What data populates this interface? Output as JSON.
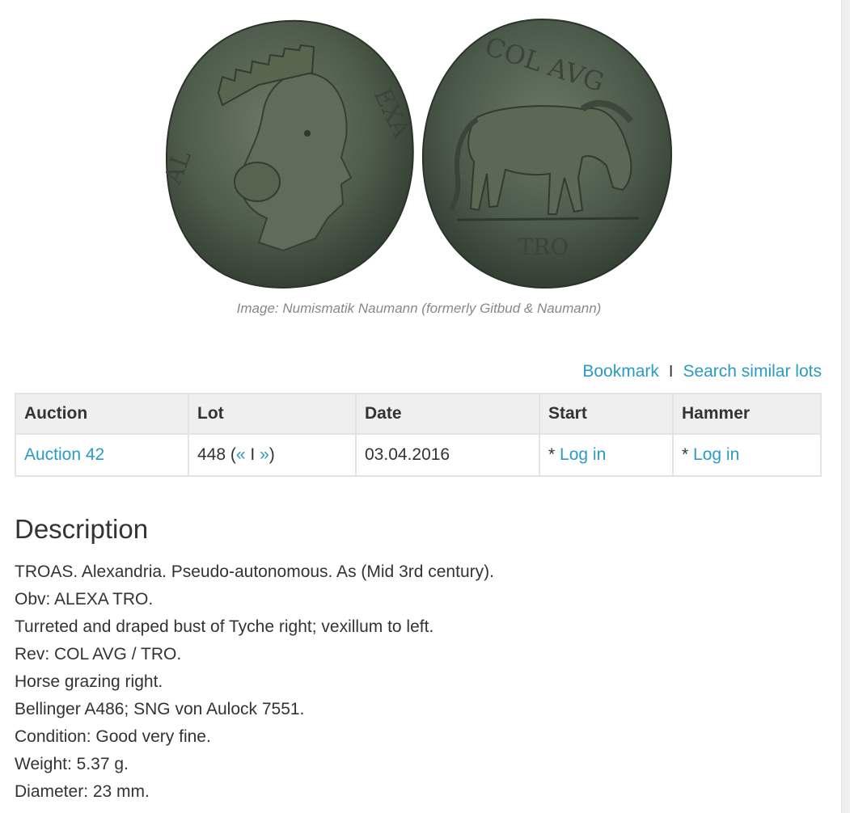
{
  "image": {
    "obverse_legend": [
      "AL",
      "EXA"
    ],
    "reverse_legend_top": "COL AVG",
    "reverse_legend_bottom": "TRO",
    "caption": "Image: Numismatik Naumann (formerly Gitbud & Naumann)"
  },
  "actions": {
    "bookmark": "Bookmark",
    "separator": "I",
    "search_similar": "Search similar lots"
  },
  "table": {
    "headers": [
      "Auction",
      "Lot",
      "Date",
      "Start",
      "Hammer"
    ],
    "row": {
      "auction": "Auction 42",
      "lot_number": "448",
      "lot_prev": "«",
      "lot_sep": "I",
      "lot_next": "»",
      "date": "03.04.2016",
      "start_prefix": "*",
      "start_link": "Log in",
      "hammer_prefix": "*",
      "hammer_link": "Log in"
    }
  },
  "description": {
    "heading": "Description",
    "lines": [
      "TROAS. Alexandria. Pseudo-autonomous. As (Mid 3rd century).",
      "Obv: ALEXA TRO.",
      "Turreted and draped bust of Tyche right; vexillum to left.",
      "Rev: COL AVG / TRO.",
      "Horse grazing right.",
      "Bellinger A486; SNG von Aulock 7551.",
      "Condition: Good very fine.",
      "Weight: 5.37 g.",
      "Diameter: 23 mm."
    ]
  },
  "colors": {
    "link": "#2a9bc4",
    "text": "#333333",
    "caption": "#888888",
    "table_header_bg": "#efefef",
    "table_border": "#e4e4e4",
    "coin_patina": "#4f5e4c"
  }
}
